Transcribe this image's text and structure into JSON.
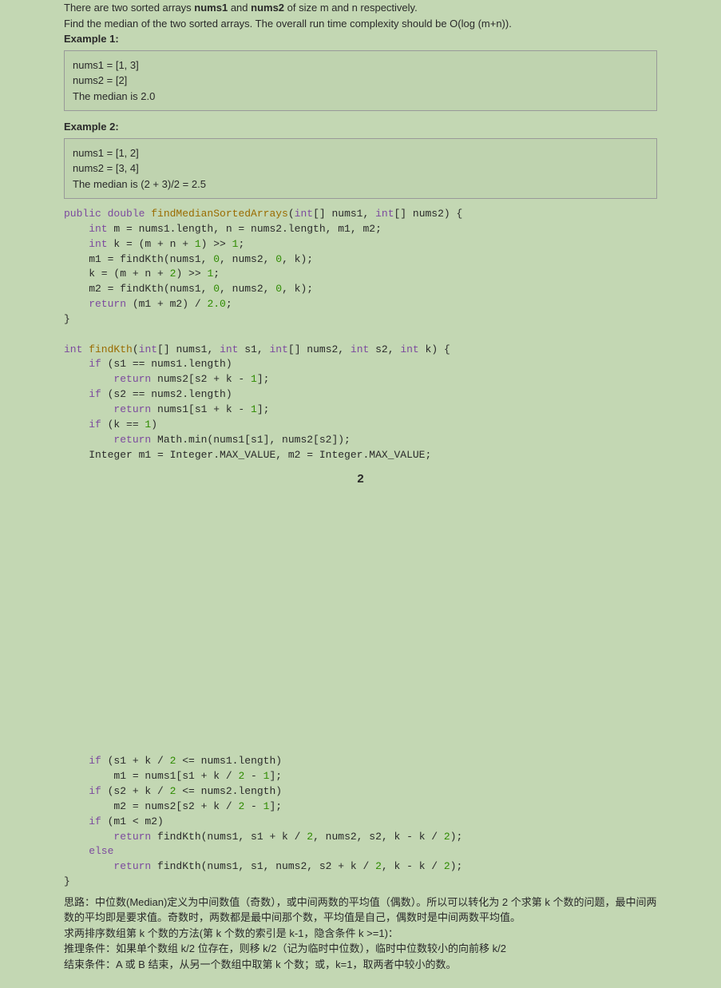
{
  "intro": {
    "line1_a": "There are two sorted arrays ",
    "line1_b": " and ",
    "line1_c": " of size m and n respectively.",
    "nums1": "nums1",
    "nums2": "nums2",
    "line2": "Find the median of the two sorted arrays. The overall run time complexity should be O(log (m+n)).",
    "ex1label": "Example 1:",
    "ex1_l1": "nums1 = [1, 3]",
    "ex1_l2": "nums2 = [2]",
    "ex1_l3": "The median is 2.0",
    "ex2label": "Example 2:",
    "ex2_l1": "nums1 = [1, 2]",
    "ex2_l2": "nums2 = [3, 4]",
    "ex2_l3": "The median is (2 + 3)/2 = 2.5"
  },
  "code": {
    "l01a": "public",
    "l01b": " double",
    "l01c": " findMedianSortedArrays",
    "l01d": "(",
    "l01e": "int",
    "l01f": "[] nums1, ",
    "l01g": "int",
    "l01h": "[] nums2) {",
    "l02a": "    int",
    "l02b": " m = nums1.length, n = nums2.length, m1, m2;",
    "l03a": "    int",
    "l03b": " k = (m + n + ",
    "l03c": "1",
    "l03d": ") >> ",
    "l03e": "1",
    "l03f": ";",
    "l04a": "    m1 = findKth(nums1, ",
    "l04b": "0",
    "l04c": ", nums2, ",
    "l04d": "0",
    "l04e": ", k);",
    "l05a": "    k = (m + n + ",
    "l05b": "2",
    "l05c": ") >> ",
    "l05d": "1",
    "l05e": ";",
    "l06a": "    m2 = findKth(nums1, ",
    "l06b": "0",
    "l06c": ", nums2, ",
    "l06d": "0",
    "l06e": ", k);",
    "l07a": "    return",
    "l07b": " (m1 + m2) / ",
    "l07c": "2.0",
    "l07d": ";",
    "l08": "}",
    "l10a": "int",
    "l10b": " findKth",
    "l10c": "(",
    "l10d": "int",
    "l10e": "[] nums1, ",
    "l10f": "int",
    "l10g": " s1, ",
    "l10h": "int",
    "l10i": "[] nums2, ",
    "l10j": "int",
    "l10k": " s2, ",
    "l10l": "int",
    "l10m": " k) {",
    "l11a": "    if",
    "l11b": " (s1 == nums1.length)",
    "l12a": "        return",
    "l12b": " nums2[s2 + k - ",
    "l12c": "1",
    "l12d": "];",
    "l13a": "    if",
    "l13b": " (s2 == nums2.length)",
    "l14a": "        return",
    "l14b": " nums1[s1 + k - ",
    "l14c": "1",
    "l14d": "];",
    "l15a": "    if",
    "l15b": " (k == ",
    "l15c": "1",
    "l15d": ")",
    "l16a": "        return",
    "l16b": " Math.min(nums1[s1], nums2[s2]);",
    "l17a": "    Integer m1 = Integer.MAX_VALUE, m2 = Integer.MAX_VALUE;"
  },
  "pagenum": "2",
  "code2": {
    "l20a": "    if",
    "l20b": " (s1 + k / ",
    "l20c": "2",
    "l20d": " <= nums1.length)",
    "l21a": "        m1 = nums1[s1 + k / ",
    "l21b": "2",
    "l21c": " - ",
    "l21d": "1",
    "l21e": "];",
    "l22a": "    if",
    "l22b": " (s2 + k / ",
    "l22c": "2",
    "l22d": " <= nums2.length)",
    "l23a": "        m2 = nums2[s2 + k / ",
    "l23b": "2",
    "l23c": " - ",
    "l23d": "1",
    "l23e": "];",
    "l24a": "    if",
    "l24b": " (m1 < m2)",
    "l25a": "        return",
    "l25b": " findKth(nums1, s1 + k / ",
    "l25c": "2",
    "l25d": ", nums2, s2, k - k / ",
    "l25e": "2",
    "l25f": ");",
    "l26a": "    else",
    "l27a": "        return",
    "l27b": " findKth(nums1, s1, nums2, s2 + k / ",
    "l27c": "2",
    "l27d": ", k - k / ",
    "l27e": "2",
    "l27f": ");",
    "l28": "}"
  },
  "explain": {
    "p1": "思路：中位数(Median)定义为中间数值（奇数），或中间两数的平均值（偶数）。所以可以转化为 2 个求第 k 个数的问题，最中间两数的平均即是要求值。奇数时，两数都是最中间那个数，平均值是自己，偶数时是中间两数平均值。",
    "p2": "求两排序数组第 k 个数的方法(第 k 个数的索引是 k-1，隐含条件 k >=1)：",
    "p3": "推理条件：如果单个数组 k/2 位存在，则移 k/2（记为临时中位数），临时中位数较小的向前移 k/2",
    "p4": "结束条件：A 或 B 结束，从另一个数组中取第 k 个数；或，k=1，取两者中较小的数。"
  }
}
